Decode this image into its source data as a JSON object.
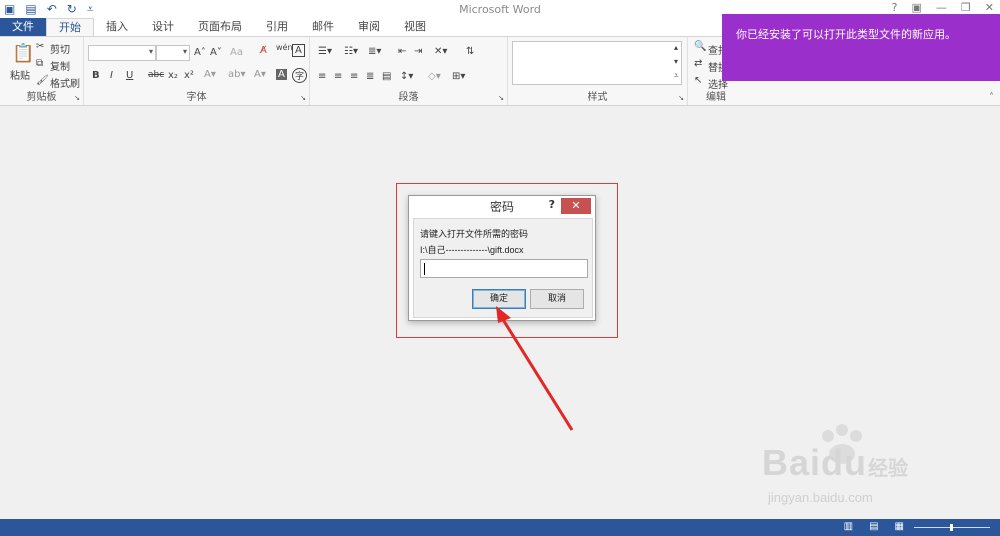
{
  "window": {
    "title": "Microsoft Word",
    "controls": [
      "?",
      "▣",
      "—",
      "❐",
      "✕"
    ]
  },
  "qat": {
    "icons": [
      "word-icon",
      "save-icon",
      "undo-icon",
      "redo-icon",
      "customize-icon"
    ]
  },
  "tabs": [
    {
      "label": "文件"
    },
    {
      "label": "开始"
    },
    {
      "label": "插入"
    },
    {
      "label": "设计"
    },
    {
      "label": "页面布局"
    },
    {
      "label": "引用"
    },
    {
      "label": "邮件"
    },
    {
      "label": "审阅"
    },
    {
      "label": "视图"
    }
  ],
  "ribbon": {
    "clipboard": {
      "label": "剪贴板",
      "paste": "粘贴",
      "cut": "剪切",
      "copy": "复制",
      "format_painter": "格式刷"
    },
    "font": {
      "label": "字体",
      "grow": "A˄",
      "shrink": "A˅",
      "case": "Aa",
      "bold": "B",
      "italic": "I",
      "underline": "U",
      "strike": "abc",
      "sub": "x₂",
      "sup": "x²",
      "phonetic": "wén",
      "border_char": "A",
      "enclose_char": "字"
    },
    "paragraph": {
      "label": "段落"
    },
    "styles": {
      "label": "样式"
    },
    "editing": {
      "label": "编辑",
      "find": "查找",
      "replace": "替换",
      "select": "选择"
    }
  },
  "notification": {
    "text": "你已经安装了可以打开此类型文件的新应用。"
  },
  "dialog": {
    "title": "密码",
    "help": "?",
    "close": "✕",
    "prompt": "请键入打开文件所需的密码",
    "filepath": "I:\\自己--------------\\gift.docx",
    "password_value": "",
    "ok": "确定",
    "cancel": "取消"
  },
  "annotation": {
    "color": "#e32626"
  },
  "watermark": {
    "brand": "Baidu",
    "cn": "经验",
    "url": "jingyan.baidu.com"
  },
  "colors": {
    "accent": "#2b579a",
    "notify": "#9a2fcb",
    "close": "#c75050"
  }
}
